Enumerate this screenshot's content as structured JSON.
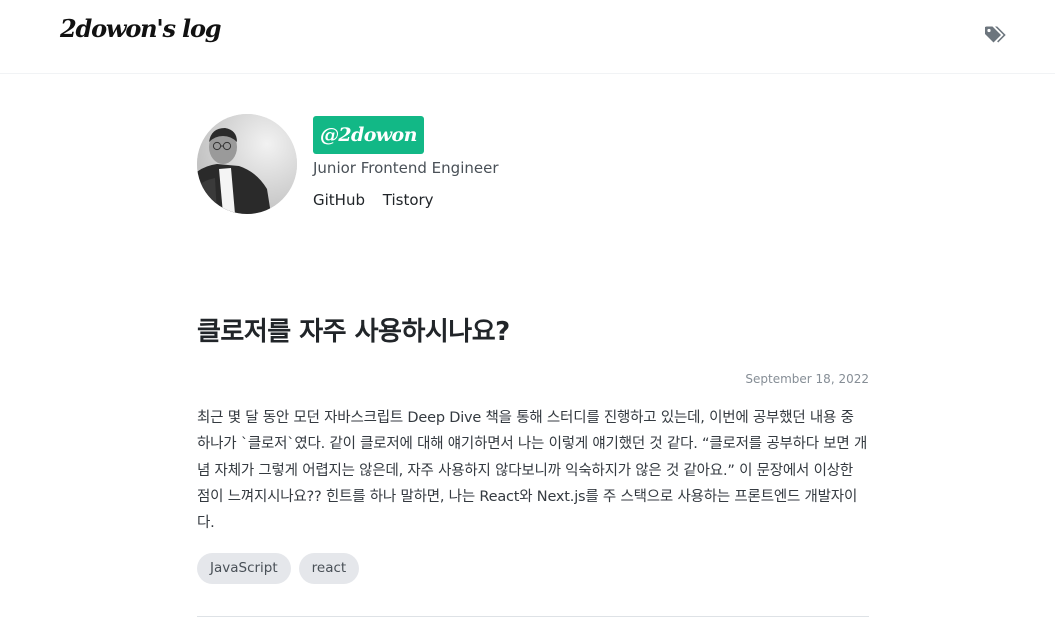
{
  "header": {
    "site_title": "2dowon's log",
    "tags_icon": "tags-icon"
  },
  "profile": {
    "avatar_icon": "profile-photo",
    "handle": "@2dowon",
    "bio": "Junior Frontend Engineer",
    "links": [
      "GitHub",
      "Tistory"
    ]
  },
  "post": {
    "title": "클로저를 자주 사용하시나요?",
    "date": "September 18, 2022",
    "excerpt": "최근 몇 달 동안 모던 자바스크립트 Deep Dive 책을 통해 스터디를 진행하고 있는데, 이번에 공부했던 내용 중 하나가 `클로저`였다. 같이 클로저에 대해 얘기하면서 나는 이렇게 얘기했던 것 같다. “클로저를 공부하다 보면 개념 자체가 그렇게 어렵지는 않은데, 자주 사용하지 않다보니까 익숙하지가 않은 것 같아요.” 이 문장에서 이상한 점이 느껴지시나요?? 힌트를 하나 말하면, 나는 React와 Next.js를 주 스택으로 사용하는 프론트엔드 개발자이다.",
    "tags": [
      "JavaScript",
      "react"
    ]
  },
  "colors": {
    "accent": "#12b886",
    "tag_bg": "#e5e7eb",
    "date": "#868e96"
  }
}
